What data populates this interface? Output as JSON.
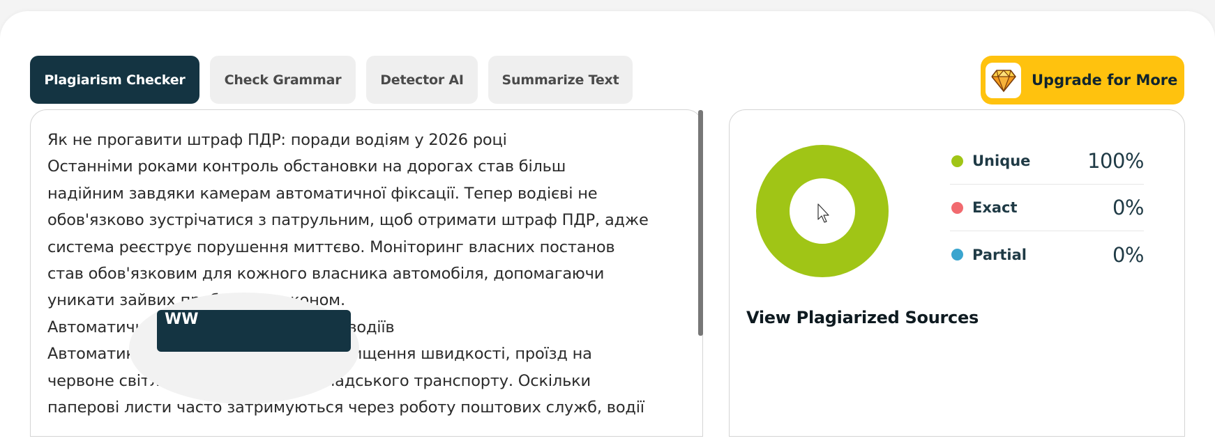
{
  "tabs": [
    {
      "label": "Plagiarism Checker",
      "active": true
    },
    {
      "label": "Check Grammar",
      "active": false
    },
    {
      "label": "Detector AI",
      "active": false
    },
    {
      "label": "Summarize Text",
      "active": false
    }
  ],
  "upgrade": {
    "label": "Upgrade for More",
    "icon": "diamond-icon"
  },
  "editor": {
    "lines": [
      "Як не прогавити штраф ПДР: поради водіям у 2026 році",
      "Останніми роками контроль обстановки на дорогах став більш",
      "надійним завдяки камерам автоматичної фіксації. Тепер водієві не",
      "обов'язково зустрічатися з патрульним, щоб отримати штраф ПДР, адже",
      "система реєструє порушення миттєво. Моніторинг власних постанов",
      "став обов'язковим для кожного власника автомобіля, допомагаючи",
      "уникати зайвих проблем із законом.",
      "Автоматична фіксація та пільги для водіїв",
      "Автоматика цілодобово фіксує перевищення швидкості, проїзд на",
      "червоне світло чи рух смугою громадського транспорту. Оскільки",
      "паперові листи часто затримуються через роботу поштових служб, водії"
    ]
  },
  "results": {
    "chart": {
      "unique": 100,
      "exact": 0,
      "partial": 0
    },
    "legend": [
      {
        "label": "Unique",
        "value": "100%",
        "color": "#a0c516"
      },
      {
        "label": "Exact",
        "value": "0%",
        "color": "#f16a6f"
      },
      {
        "label": "Partial",
        "value": "0%",
        "color": "#3aa5cf"
      }
    ],
    "sources_title": "View Plagiarized Sources",
    "illustration_text": "WW"
  }
}
